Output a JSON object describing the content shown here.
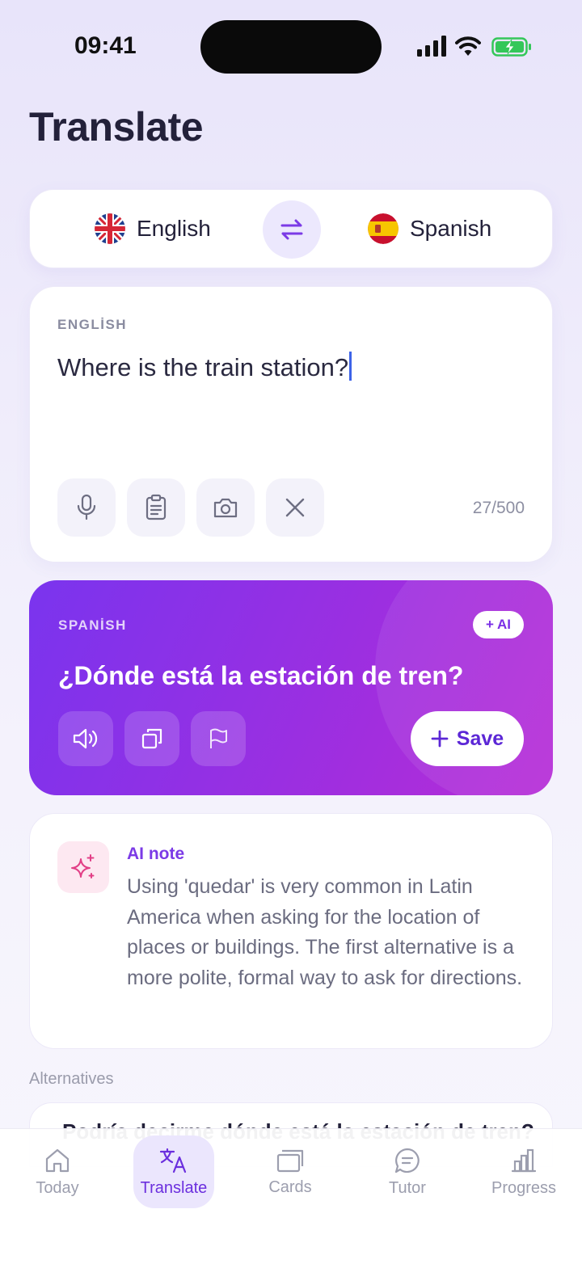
{
  "status_bar": {
    "time": "09:41"
  },
  "header": {
    "title": "Translate"
  },
  "language_bar": {
    "source_language": "English",
    "target_language": "Spanish",
    "source_flag_icon": "uk-flag-icon",
    "target_flag_icon": "spain-flag-icon"
  },
  "input_card": {
    "caption": "ENGLİSH",
    "text": "Where is the train station?",
    "char_count": "27/500",
    "actions": [
      "microphone-icon",
      "clipboard-icon",
      "camera-icon",
      "close-icon"
    ]
  },
  "result_card": {
    "caption": "SPANİSH",
    "badge": "+ AI",
    "text": "¿Dónde está la estación de tren?",
    "actions": [
      "speaker-icon",
      "copy-icon",
      "flag-icon"
    ],
    "save_label": "Save"
  },
  "ai_note": {
    "title": "AI note",
    "text": "Using 'quedar' is very common in Latin America when asking for the location of places or buildings. The first alternative is a more polite, formal way to ask for directions."
  },
  "alternatives": {
    "label": "Alternatives",
    "items": [
      "Podría decirme dónde está la estación de tren?"
    ]
  },
  "tab_bar": {
    "items": [
      {
        "label": "Today",
        "icon": "home-icon"
      },
      {
        "label": "Translate",
        "icon": "translate-icon",
        "active": true
      },
      {
        "label": "Cards",
        "icon": "cards-icon"
      },
      {
        "label": "Tutor",
        "icon": "chat-icon"
      },
      {
        "label": "Progress",
        "icon": "bar-chart-icon"
      }
    ]
  },
  "colors": {
    "accent": "#7b2fe6",
    "caret": "#3d63e8",
    "battery": "#34c759"
  }
}
